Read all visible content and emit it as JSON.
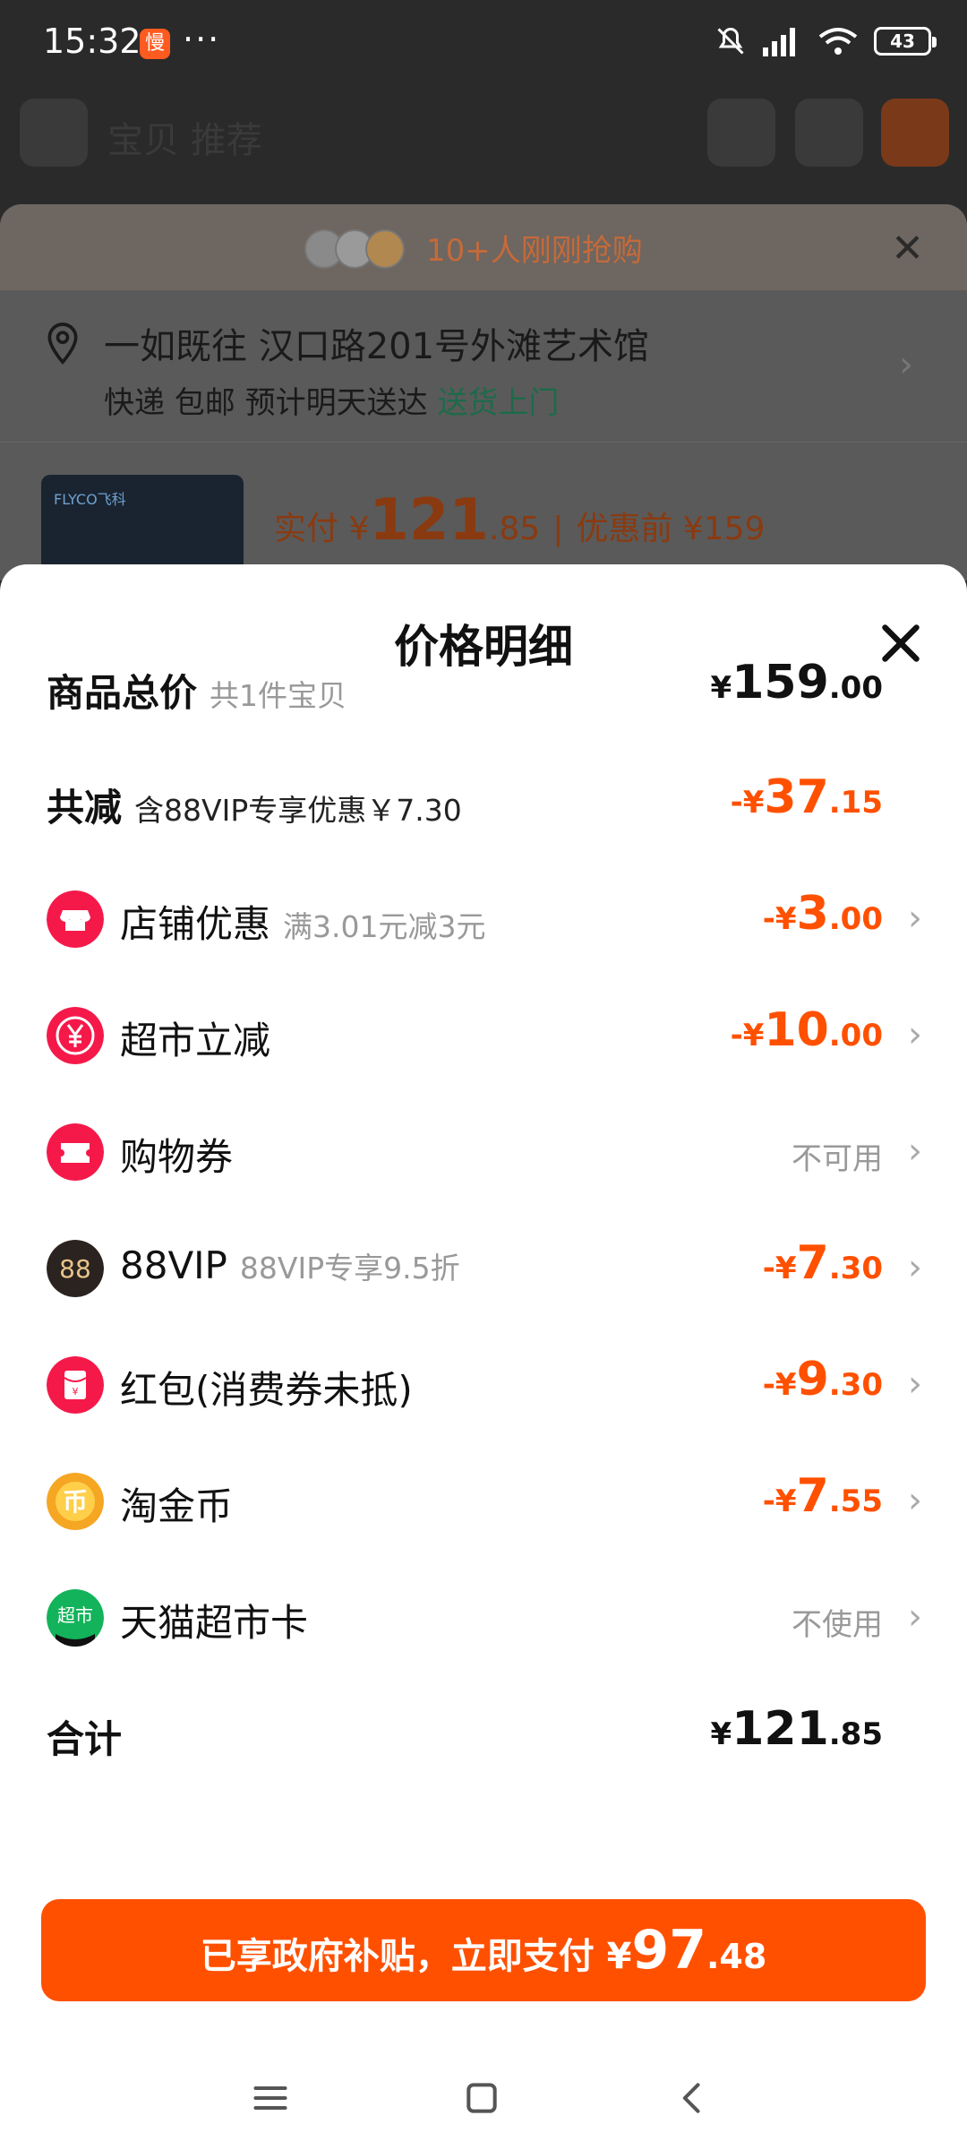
{
  "status": {
    "time": "15:32",
    "app_badge": "慢",
    "dots": "···",
    "battery": "43"
  },
  "background": {
    "header_title": "宝贝 推荐",
    "banner_text": "10+人刚刚抢购",
    "address": "一如既往 汉口路201号外滩艺术馆",
    "delivery": "快递 包邮 预计明天送达",
    "delivery_highlight": "送货上门",
    "product_brand": "FLYCO飞科",
    "price_prefix": "实付 ¥",
    "price_main": "121",
    "price_dec": ".85",
    "price_before": "优惠前 ¥159"
  },
  "sheet": {
    "title": "价格明细",
    "rows": [
      {
        "label": "商品总价",
        "sub": "共1件宝贝",
        "currency": "¥",
        "int": "159",
        "dec": ".00"
      },
      {
        "label": "共减",
        "sub": "含88VIP专享优惠￥7.30",
        "currency": "-¥",
        "int": "37",
        "dec": ".15"
      },
      {
        "label": "店铺优惠",
        "sub": "满3.01元减3元",
        "currency": "-¥",
        "int": "3",
        "dec": ".00",
        "icon": "store-icon"
      },
      {
        "label": "超市立减",
        "sub": "",
        "currency": "-¥",
        "int": "10",
        "dec": ".00",
        "icon": "yuan-icon"
      },
      {
        "label": "购物券",
        "sub": "",
        "text": "不可用",
        "icon": "ticket-icon"
      },
      {
        "label": "88VIP",
        "sub": "88VIP专享9.5折",
        "currency": "-¥",
        "int": "7",
        "dec": ".30",
        "icon": "vip88-icon"
      },
      {
        "label": "红包(消费券未抵)",
        "sub": "",
        "currency": "-¥",
        "int": "9",
        "dec": ".30",
        "icon": "red-packet-icon"
      },
      {
        "label": "淘金币",
        "sub": "",
        "currency": "-¥",
        "int": "7",
        "dec": ".55",
        "icon": "coin-icon"
      },
      {
        "label": "天猫超市卡",
        "sub": "",
        "text": "不使用",
        "icon": "tmall-supermarket-icon"
      },
      {
        "label": "合计",
        "sub": "",
        "currency": "¥",
        "int": "121",
        "dec": ".85"
      }
    ],
    "pay_button": {
      "text": "已享政府补贴，立即支付 ¥",
      "int": "97",
      "dec": ".48"
    }
  },
  "colors": {
    "accent": "#ff5000",
    "icon_red": "#f5194a",
    "coin": "#f5a623",
    "vip_dark": "#2a2320",
    "green": "#12b35a"
  }
}
